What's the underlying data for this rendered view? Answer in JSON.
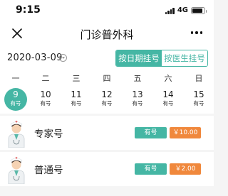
{
  "status_bar": {
    "time": "9:15",
    "network": "4G",
    "battery_level": 0.85
  },
  "nav": {
    "title": "门诊普外科",
    "close_icon": "close-icon",
    "more_icon": "more-icon"
  },
  "date_bar": {
    "current_date": "2020-03-09",
    "toggle_icon": "chevron-down-circle-icon",
    "mode_tabs": [
      {
        "label": "按日期挂号",
        "active": true
      },
      {
        "label": "按医生挂号",
        "active": false
      }
    ]
  },
  "calendar": {
    "weekdays": [
      "一",
      "二",
      "三",
      "四",
      "五",
      "六",
      "日"
    ],
    "days": [
      {
        "num": "9",
        "status": "有号",
        "selected": true
      },
      {
        "num": "10",
        "status": "有号",
        "selected": false
      },
      {
        "num": "11",
        "status": "有号",
        "selected": false
      },
      {
        "num": "12",
        "status": "有号",
        "selected": false
      },
      {
        "num": "13",
        "status": "有号",
        "selected": false
      },
      {
        "num": "14",
        "status": "有号",
        "selected": false
      },
      {
        "num": "15",
        "status": "有号",
        "selected": false
      }
    ]
  },
  "registrations": [
    {
      "name": "专家号",
      "availability": "有号",
      "price": "￥10.00",
      "avatar_icon": "doctor-avatar-icon"
    },
    {
      "name": "普通号",
      "availability": "有号",
      "price": "￥2.00",
      "avatar_icon": "doctor-avatar-icon"
    }
  ],
  "colors": {
    "accent": "#45b6a4",
    "price": "#f0883c",
    "background": "#f5f5f5"
  }
}
